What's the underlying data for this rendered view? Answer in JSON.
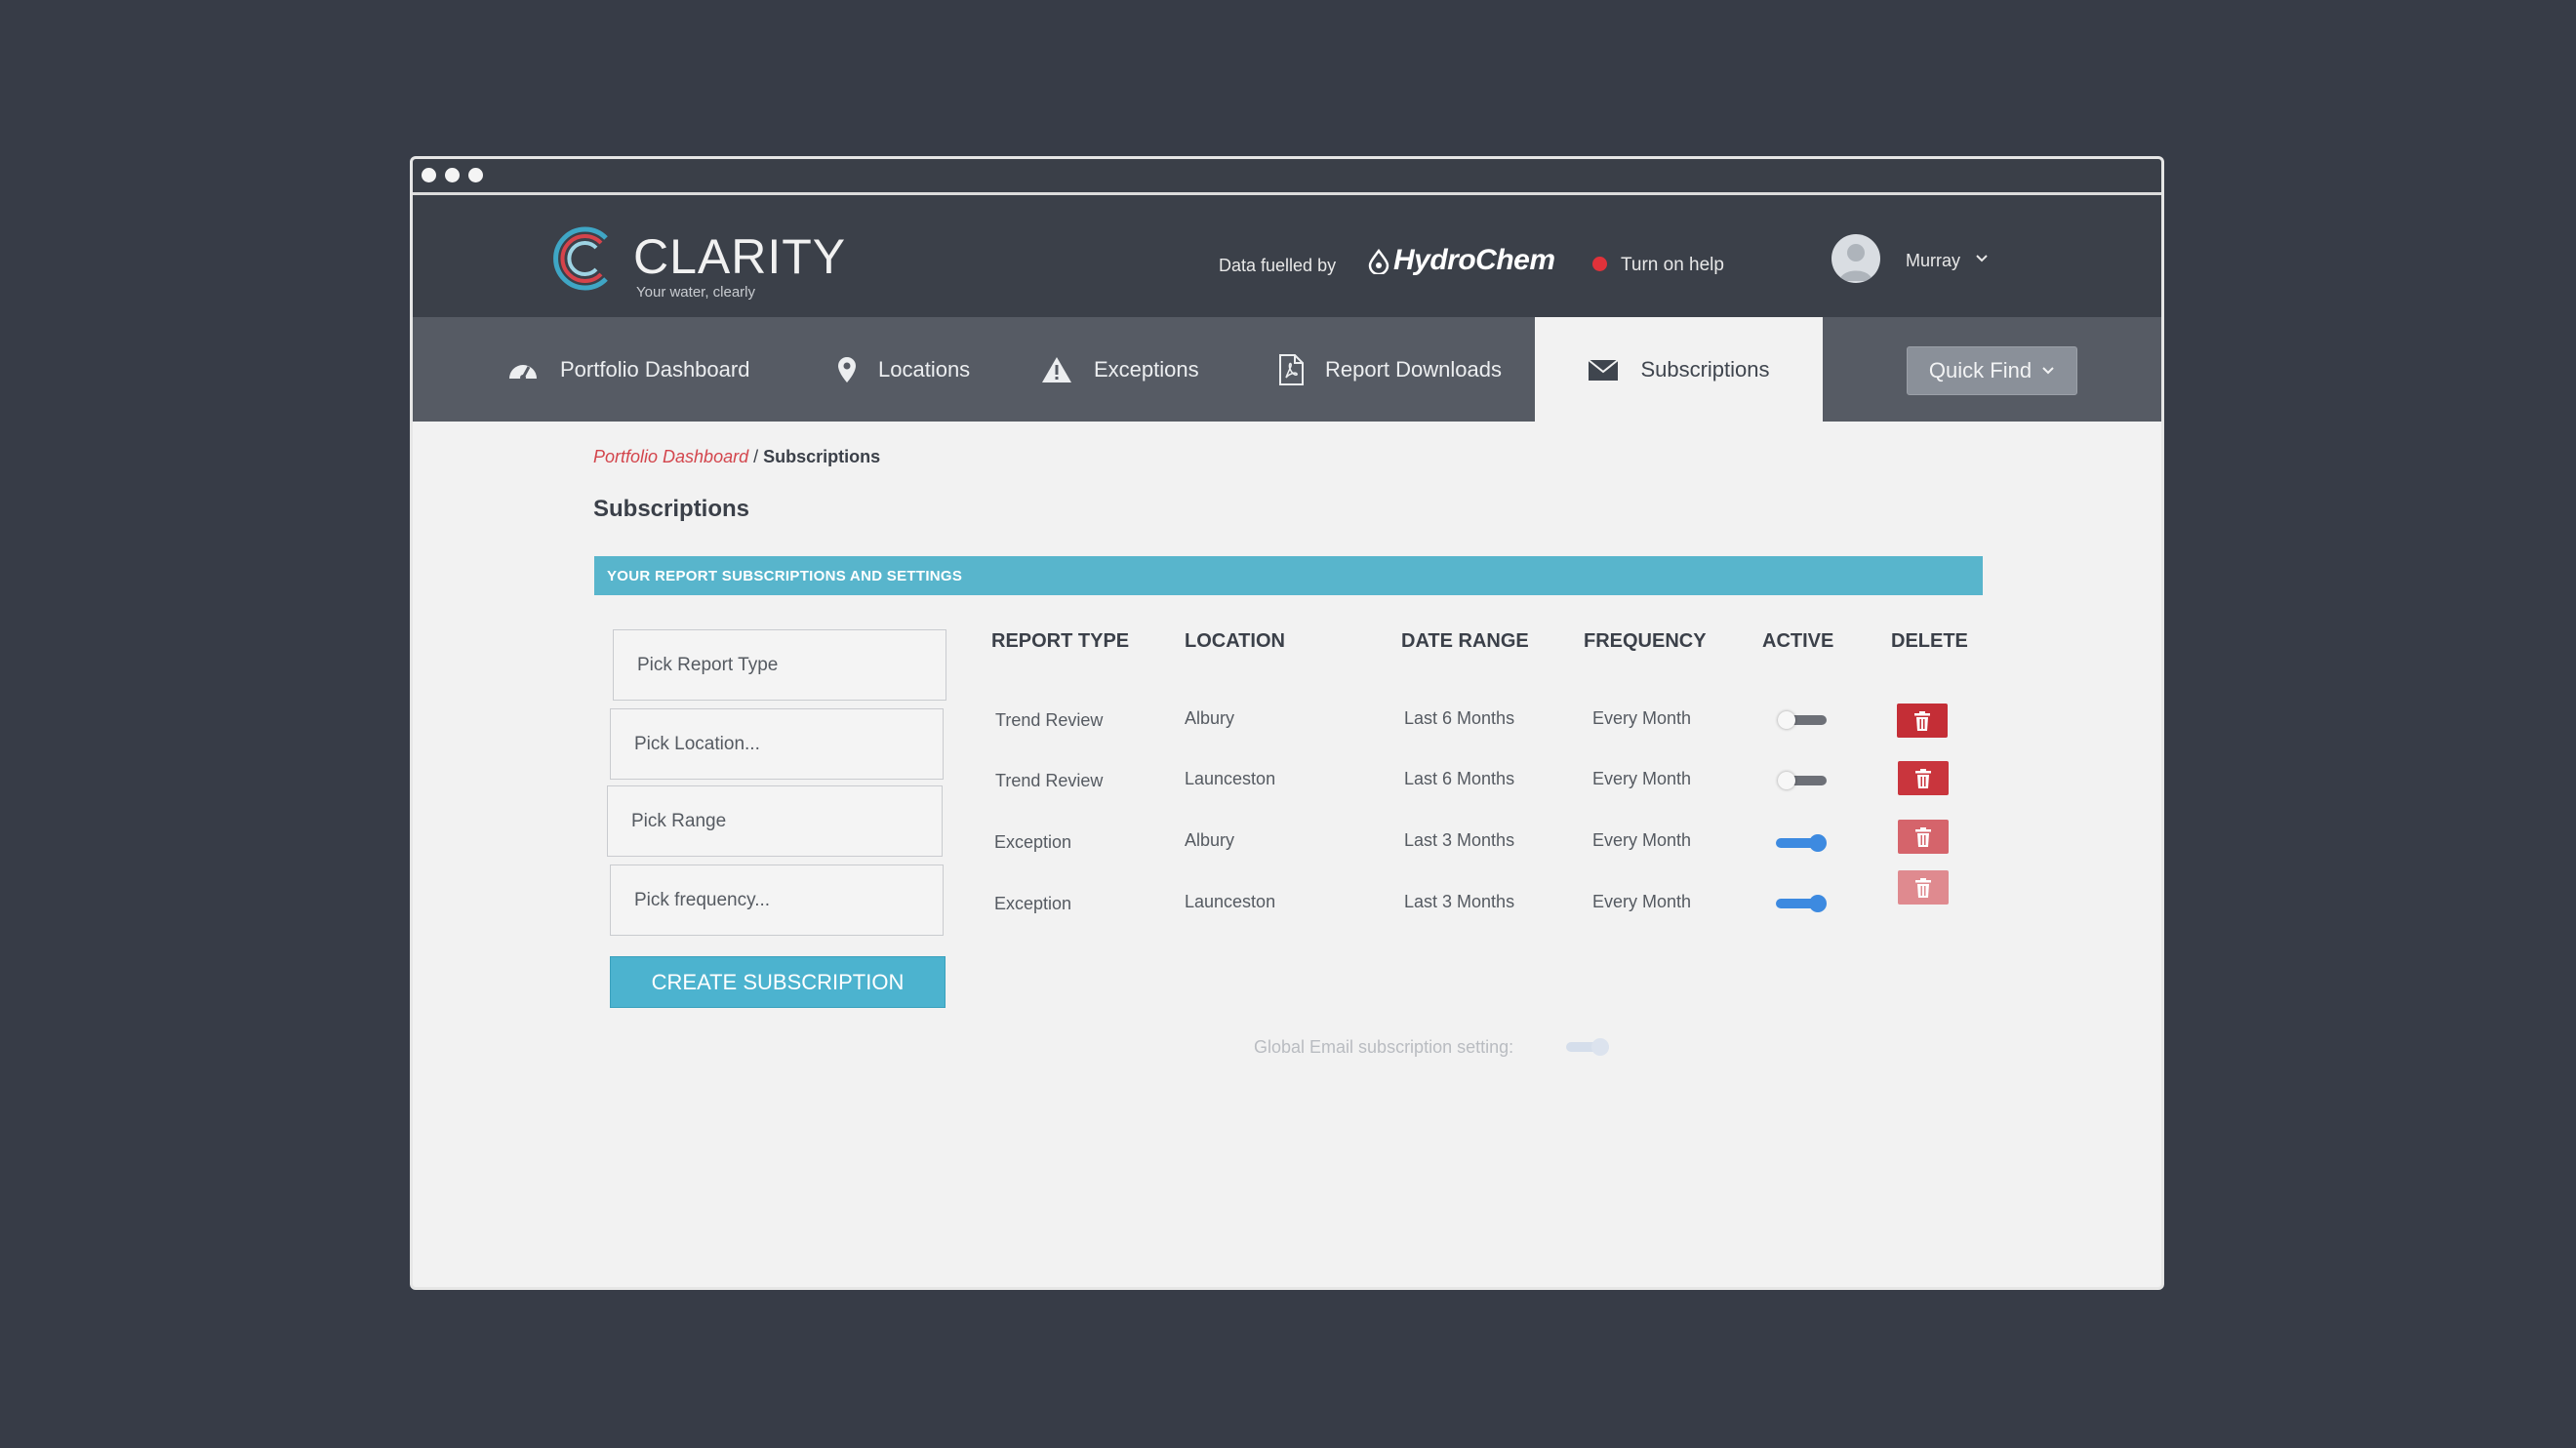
{
  "brand": {
    "name": "CLARITY",
    "tagline": "Your water, clearly",
    "fuelled_label": "Data fuelled by",
    "partner": "HydroChem"
  },
  "help": {
    "label": "Turn on help",
    "indicator_color": "#e0323a"
  },
  "user": {
    "name": "Murray"
  },
  "nav": {
    "items": [
      {
        "label": "Portfolio Dashboard",
        "icon": "dashboard-gauge-icon"
      },
      {
        "label": "Locations",
        "icon": "map-pin-icon"
      },
      {
        "label": "Exceptions",
        "icon": "warning-triangle-icon"
      },
      {
        "label": "Report Downloads",
        "icon": "pdf-file-icon"
      },
      {
        "label": "Subscriptions",
        "icon": "envelope-icon",
        "active": true
      }
    ],
    "quick_find": "Quick Find"
  },
  "breadcrumb": {
    "parent": "Portfolio Dashboard",
    "separator": " / ",
    "current": "Subscriptions"
  },
  "page": {
    "title": "Subscriptions",
    "panel_title": "YOUR REPORT SUBSCRIPTIONS AND SETTINGS"
  },
  "form": {
    "report_type_placeholder": "Pick Report Type",
    "location_placeholder": "Pick Location...",
    "range_placeholder": "Pick Range",
    "frequency_placeholder": "Pick frequency...",
    "create_label": "CREATE SUBSCRIPTION"
  },
  "table": {
    "headers": [
      "REPORT TYPE",
      "LOCATION",
      "DATE RANGE",
      "FREQUENCY",
      "ACTIVE",
      "DELETE"
    ],
    "rows": [
      {
        "report_type": "Trend Review",
        "location": "Albury",
        "date_range": "Last 6 Months",
        "frequency": "Every Month",
        "active": false
      },
      {
        "report_type": "Trend Review",
        "location": "Launceston",
        "date_range": "Last 6 Months",
        "frequency": "Every Month",
        "active": false
      },
      {
        "report_type": "Exception",
        "location": "Albury",
        "date_range": "Last 3 Months",
        "frequency": "Every Month",
        "active": true
      },
      {
        "report_type": "Exception",
        "location": "Launceston",
        "date_range": "Last 3 Months",
        "frequency": "Every Month",
        "active": true
      }
    ]
  },
  "global_setting": {
    "label": "Global Email subscription setting:",
    "enabled": true
  },
  "colors": {
    "accent": "#58b5cc",
    "delete_active": "#c42e36",
    "delete_disabled": "#df8a8f",
    "toggle_on": "#3d8ae0"
  }
}
